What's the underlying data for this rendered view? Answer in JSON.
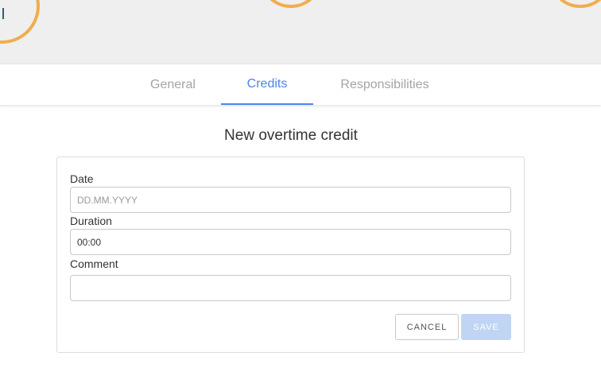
{
  "tabs": {
    "general": "General",
    "credits": "Credits",
    "responsibilities": "Responsibilities"
  },
  "form": {
    "title": "New overtime credit",
    "date_label": "Date",
    "date_placeholder": "DD.MM.YYYY",
    "duration_label": "Duration",
    "duration_value": "00:00",
    "comment_label": "Comment",
    "comment_value": "",
    "cancel_label": "CANCEL",
    "save_label": "SAVE"
  },
  "colors": {
    "accent": "#4a86e8",
    "ring": "#f0ad4e",
    "save_disabled": "#bfd5f3"
  }
}
